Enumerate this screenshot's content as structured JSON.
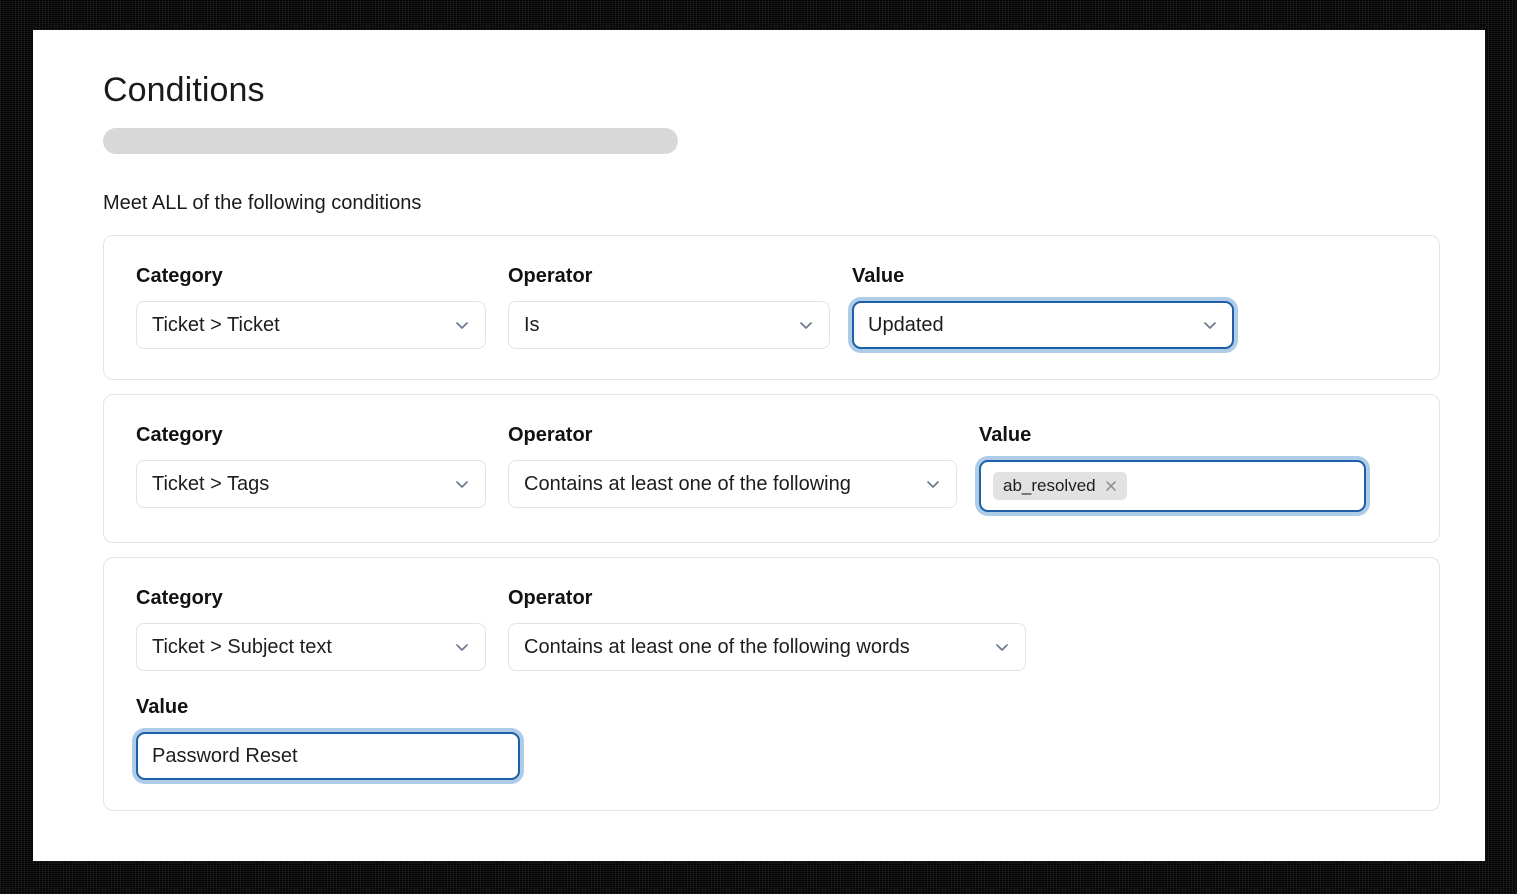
{
  "page": {
    "title": "Conditions",
    "redacted_bar": "",
    "meet_all_label": "Meet ALL of the following conditions"
  },
  "labels": {
    "category": "Category",
    "operator": "Operator",
    "value": "Value"
  },
  "icons": {
    "chevron_down": "chevron-down-icon",
    "tag_remove": "close-icon"
  },
  "colors": {
    "focus_border": "#1d5fa8",
    "focus_glow": "#aecbe8",
    "card_border": "#e4e4e6",
    "control_border": "#e3e3e5",
    "chip_background": "#e2e2e2",
    "redacted_bar": "#d8d8d8",
    "text": "#1d1d1d",
    "chevron": "#6b7a90",
    "frame": "#050505"
  },
  "conditions": [
    {
      "category": "Ticket > Ticket",
      "operator": "Is",
      "value": "Updated",
      "value_type": "select",
      "value_focused": true
    },
    {
      "category": "Ticket > Tags",
      "operator": "Contains at least one of the following",
      "value_type": "tags",
      "value_focused": true,
      "tags": [
        {
          "label": "ab_resolved",
          "remove_label": "×"
        }
      ]
    },
    {
      "category": "Ticket > Subject text",
      "operator": "Contains at least one of the following words",
      "value": "Password Reset",
      "value_type": "text",
      "value_focused": true,
      "value_on_new_line": true
    }
  ]
}
